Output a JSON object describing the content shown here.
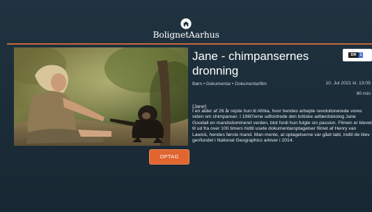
{
  "header": {
    "brand": "BolignetAarhus"
  },
  "program": {
    "title": "Jane - chimpansernes dronning",
    "genres": "Børn • Dokumentar • Dokumentarfilm",
    "airdate": "10. Jul 2021 kl. 13:05",
    "duration": "90 min",
    "original_title": "(Jane)",
    "description": "I en alder af 26 år rejste hun til Afrika, hvor hendes arbejde revolutionerede vores viden om chimpanser. I 1960'erne udfordrede den britiske adfærdsbiolog Jane Goodall en mandsdomineret verden, blot fordi hun fulgte sin passion. Filmen er blevet til ud fra over 100 timers hidtil usete dokumentaroptagelser filmet af Henry van Lawick, hendes første mand. Man mente, at optagelserne var gået tabt, indtil de blev genfundet i National Geographics arkiver i 2014.",
    "channel": {
      "logo_text": "DR",
      "logo_number": "1"
    }
  },
  "actions": {
    "record_label": "OPTAG"
  },
  "colors": {
    "background": "#1d2f3b",
    "accent": "#e0652f",
    "divider": "#c9683a"
  }
}
